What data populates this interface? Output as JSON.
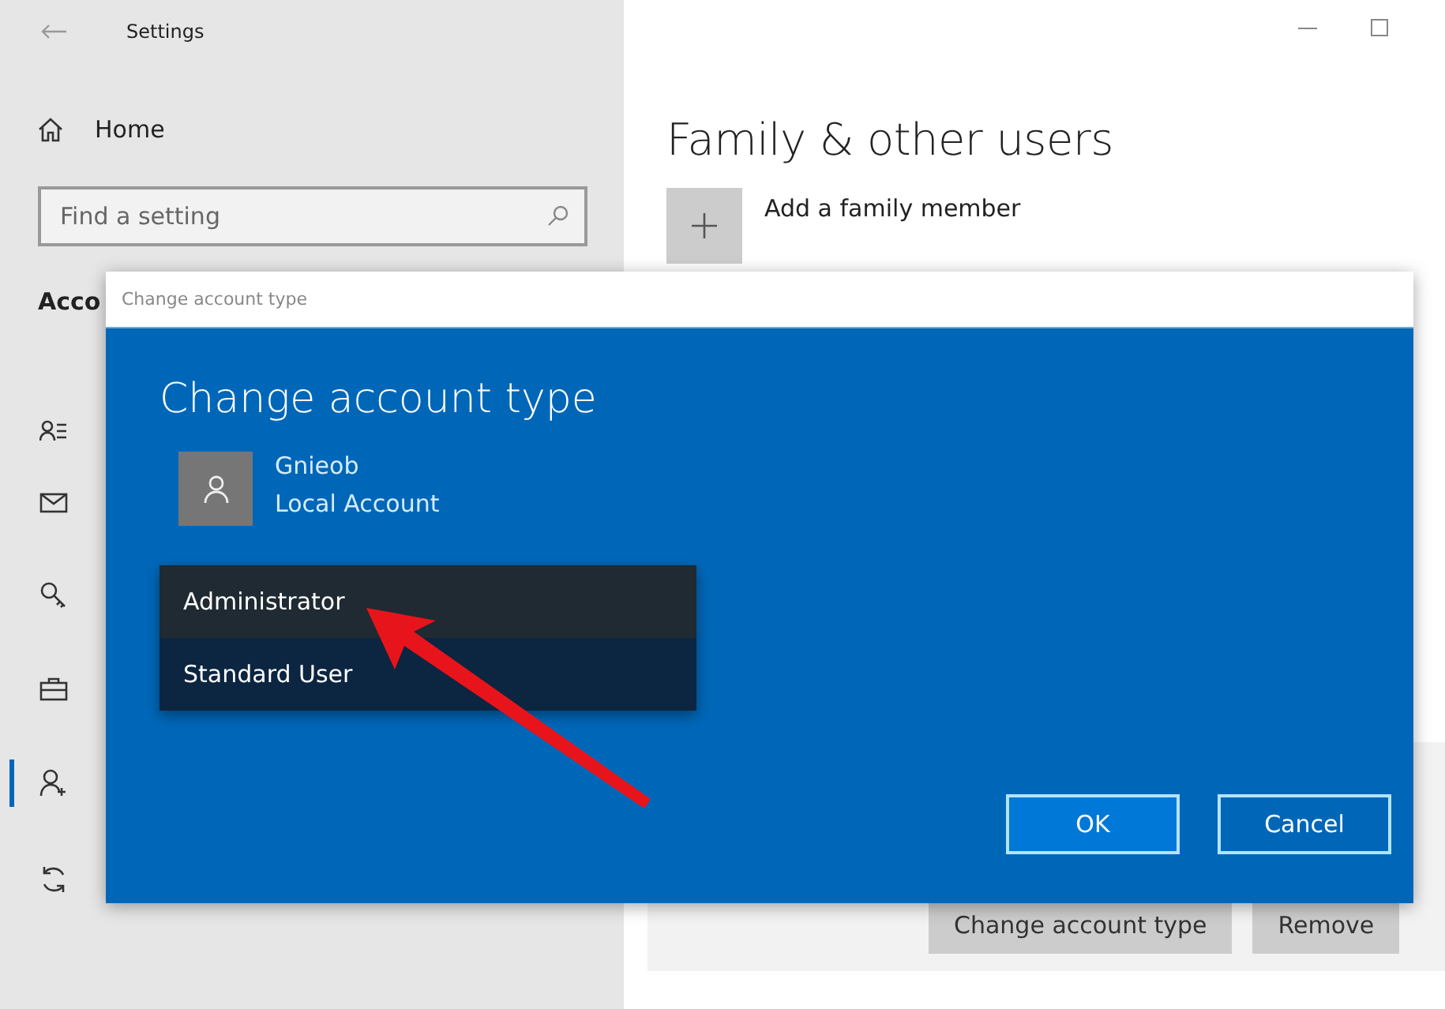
{
  "window": {
    "title": "Settings"
  },
  "sidebar": {
    "home": "Home",
    "search": {
      "placeholder": "Find a setting"
    },
    "section": "Acco",
    "items": [
      {
        "selected": false
      },
      {
        "selected": false
      },
      {
        "selected": false
      },
      {
        "selected": false
      },
      {
        "selected": true
      },
      {
        "selected": false
      }
    ]
  },
  "main": {
    "title": "Family & other users",
    "add_family": "Add a family member",
    "user_buttons": [
      "Change account type",
      "Remove"
    ]
  },
  "dialog": {
    "title_bar": "Change account type",
    "heading": "Change account type",
    "account": {
      "name": "Gnieob",
      "type": "Local Account"
    },
    "options": [
      {
        "label": "Administrator",
        "selected": true
      },
      {
        "label": "Standard User",
        "selected": false
      }
    ],
    "buttons": [
      {
        "label": "OK",
        "kind": "primary"
      },
      {
        "label": "Cancel",
        "kind": "secondary"
      }
    ]
  }
}
